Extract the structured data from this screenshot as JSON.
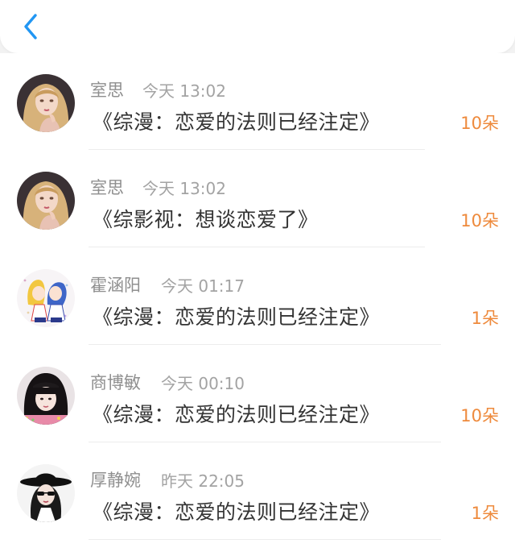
{
  "header": {
    "back_icon": "chevron-left-icon",
    "accent_color": "#2196f3"
  },
  "entries": [
    {
      "name": "室思",
      "time": "今天 13:02",
      "title": "《综漫：恋爱的法则已经注定》",
      "count": "10朵"
    },
    {
      "name": "室思",
      "time": "今天 13:02",
      "title": "《综影视：想谈恋爱了》",
      "count": "10朵"
    },
    {
      "name": "霍涵阳",
      "time": "今天 01:17",
      "title": "《综漫：恋爱的法则已经注定》",
      "count": "1朵"
    },
    {
      "name": "商博敏",
      "time": "今天 00:10",
      "title": "《综漫：恋爱的法则已经注定》",
      "count": "10朵"
    },
    {
      "name": "厚静婉",
      "time": "昨天 22:05",
      "title": "《综漫：恋爱的法则已经注定》",
      "count": "1朵"
    }
  ],
  "colors": {
    "count": "#ee8a3c",
    "name": "#8f8f8f",
    "title": "#333333"
  }
}
